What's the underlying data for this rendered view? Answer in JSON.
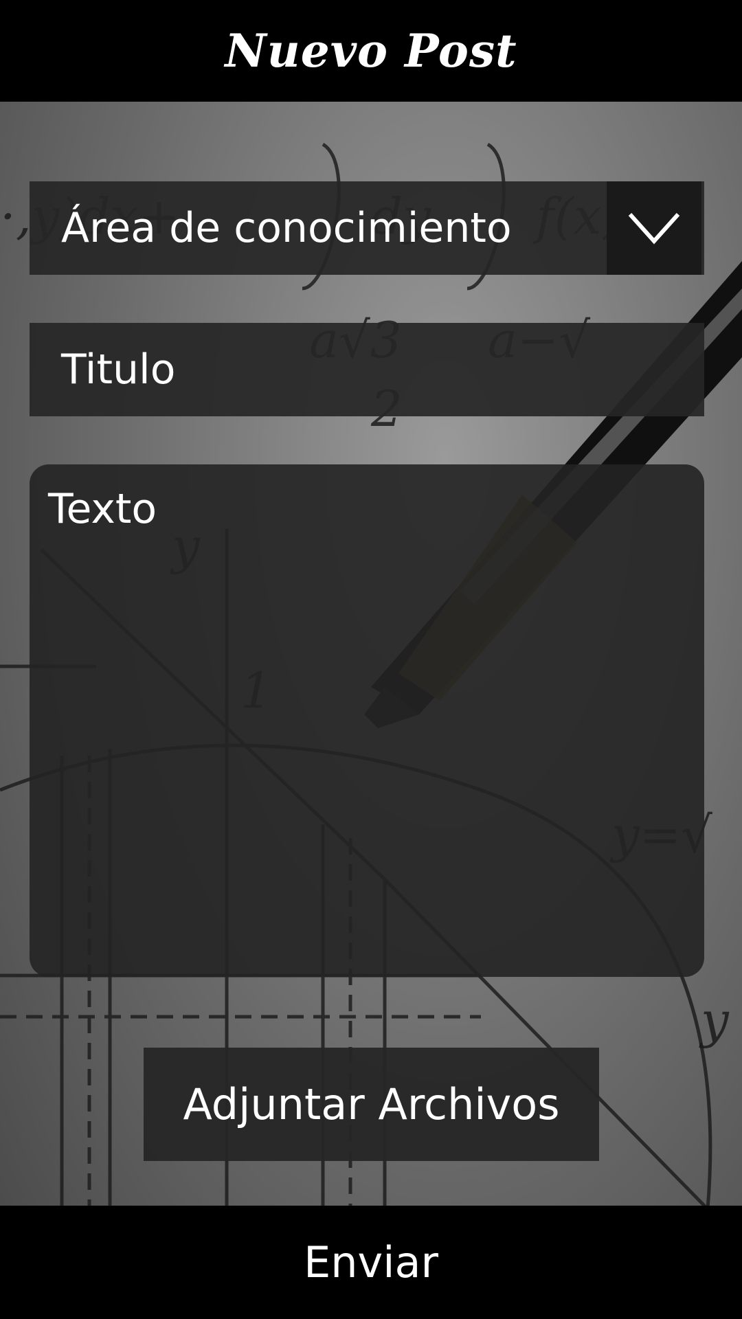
{
  "header": {
    "title": "Nuevo Post"
  },
  "form": {
    "area_select_value": "Área de conocimiento",
    "title_placeholder": "Titulo",
    "text_placeholder": "Texto",
    "attach_label": "Adjuntar Archivos"
  },
  "footer": {
    "send_label": "Enviar"
  },
  "icons": {
    "dropdown": "chevron-down-icon"
  }
}
